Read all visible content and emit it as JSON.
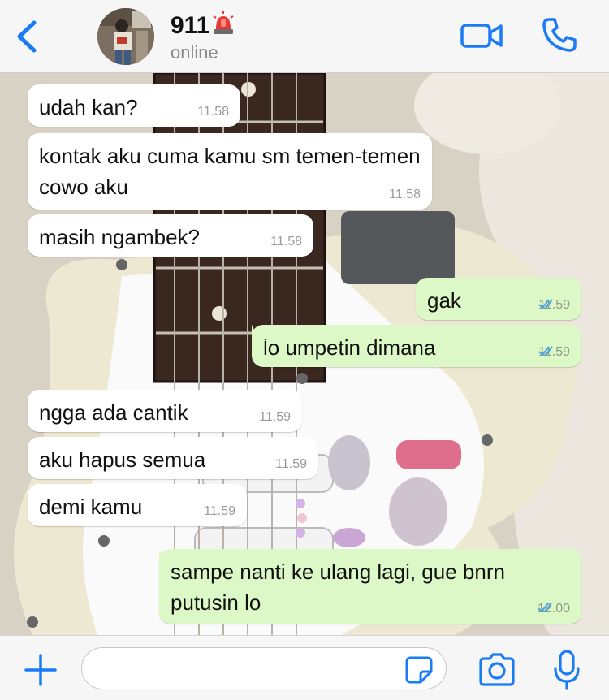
{
  "header": {
    "contact_name": "911",
    "status": "online",
    "badge_icon": "police-light-emoji",
    "accent_color": "#1a7cf5"
  },
  "messages": [
    {
      "direction": "in",
      "text": "udah kan?",
      "time": "11.58"
    },
    {
      "direction": "in",
      "text": "kontak aku cuma kamu sm temen-temen cowo aku",
      "time": "11.58"
    },
    {
      "direction": "in",
      "text": "masih ngambek?",
      "time": "11.58"
    },
    {
      "direction": "out",
      "text": "gak",
      "time": "11.59",
      "read": true
    },
    {
      "direction": "out",
      "text": "lo umpetin dimana",
      "time": "11.59",
      "read": true
    },
    {
      "direction": "in",
      "text": "ngga ada cantik",
      "time": "11.59"
    },
    {
      "direction": "in",
      "text": "aku hapus semua",
      "time": "11.59"
    },
    {
      "direction": "in",
      "text": "demi kamu",
      "time": "11.59"
    },
    {
      "direction": "out",
      "text": "sampe nanti ke ulang lagi, gue bnrn putusin lo",
      "time": "12.00",
      "read": true
    }
  ],
  "input": {
    "value": "",
    "placeholder": ""
  },
  "colors": {
    "incoming_bubble": "#ffffff",
    "outgoing_bubble": "#dcf8c6",
    "read_ticks": "#4fa3e0"
  }
}
